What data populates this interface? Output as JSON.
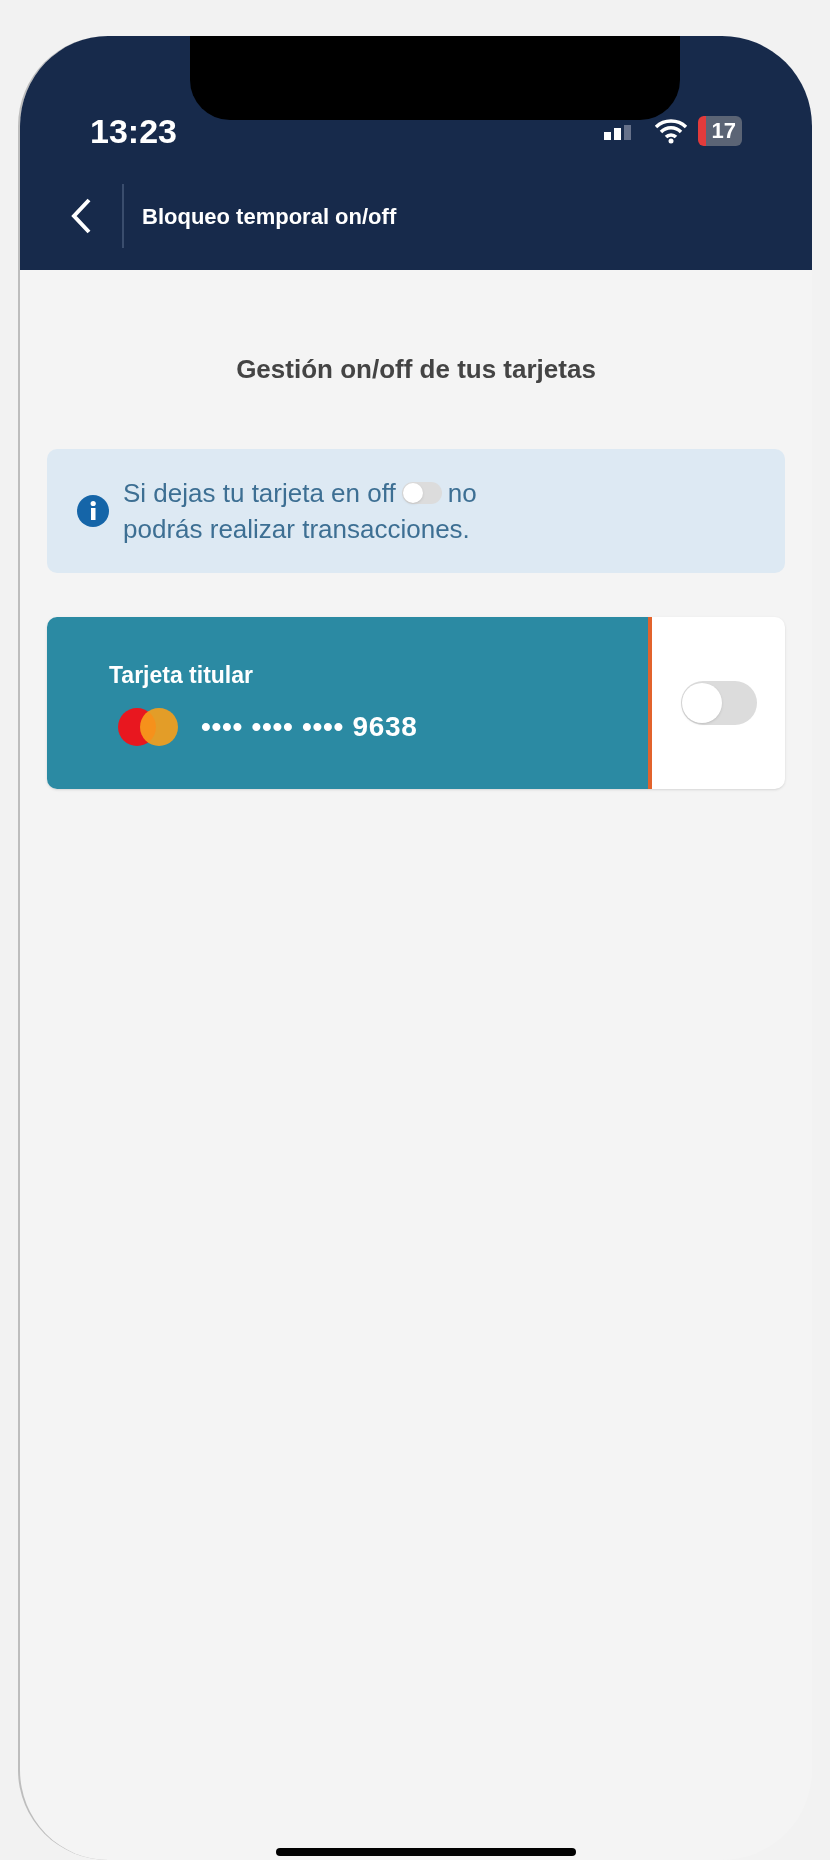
{
  "status_bar": {
    "time": "13:23",
    "battery": "17"
  },
  "nav": {
    "title": "Bloqueo temporal on/off"
  },
  "heading": "Gestión on/off de tus tarjetas",
  "info": {
    "text_before": "Si dejas tu tarjeta en off",
    "text_after": "no",
    "text_line2": "podrás realizar transacciones.",
    "sample_toggle_on": false
  },
  "cards": [
    {
      "label": "Tarjeta titular",
      "number": "•••• •••• •••• 9638",
      "on": false
    }
  ]
}
